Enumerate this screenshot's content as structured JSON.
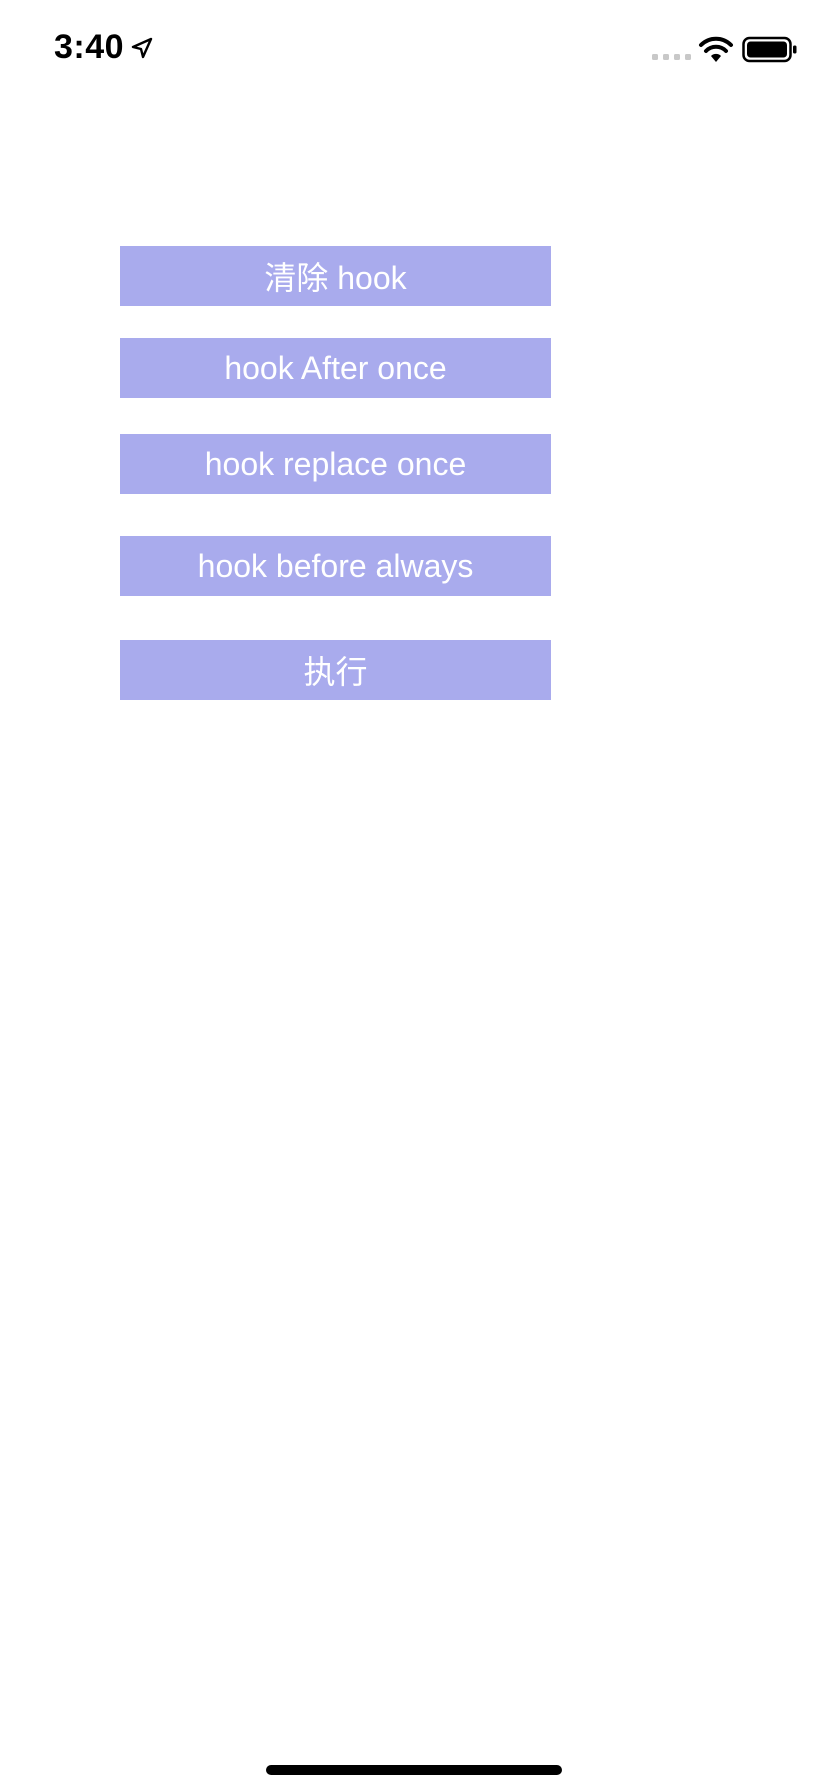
{
  "status_bar": {
    "time": "3:40",
    "location_icon": "location-arrow-icon",
    "signal_icon": "cellular-signal-icon",
    "wifi_icon": "wifi-icon",
    "battery_icon": "battery-icon"
  },
  "buttons": [
    {
      "label": "清除 hook"
    },
    {
      "label": "hook After once"
    },
    {
      "label": "hook replace once"
    },
    {
      "label": "hook before always"
    },
    {
      "label": "执行"
    }
  ],
  "colors": {
    "button_background": "#a9abed",
    "button_text": "#ffffff",
    "background": "#ffffff"
  }
}
